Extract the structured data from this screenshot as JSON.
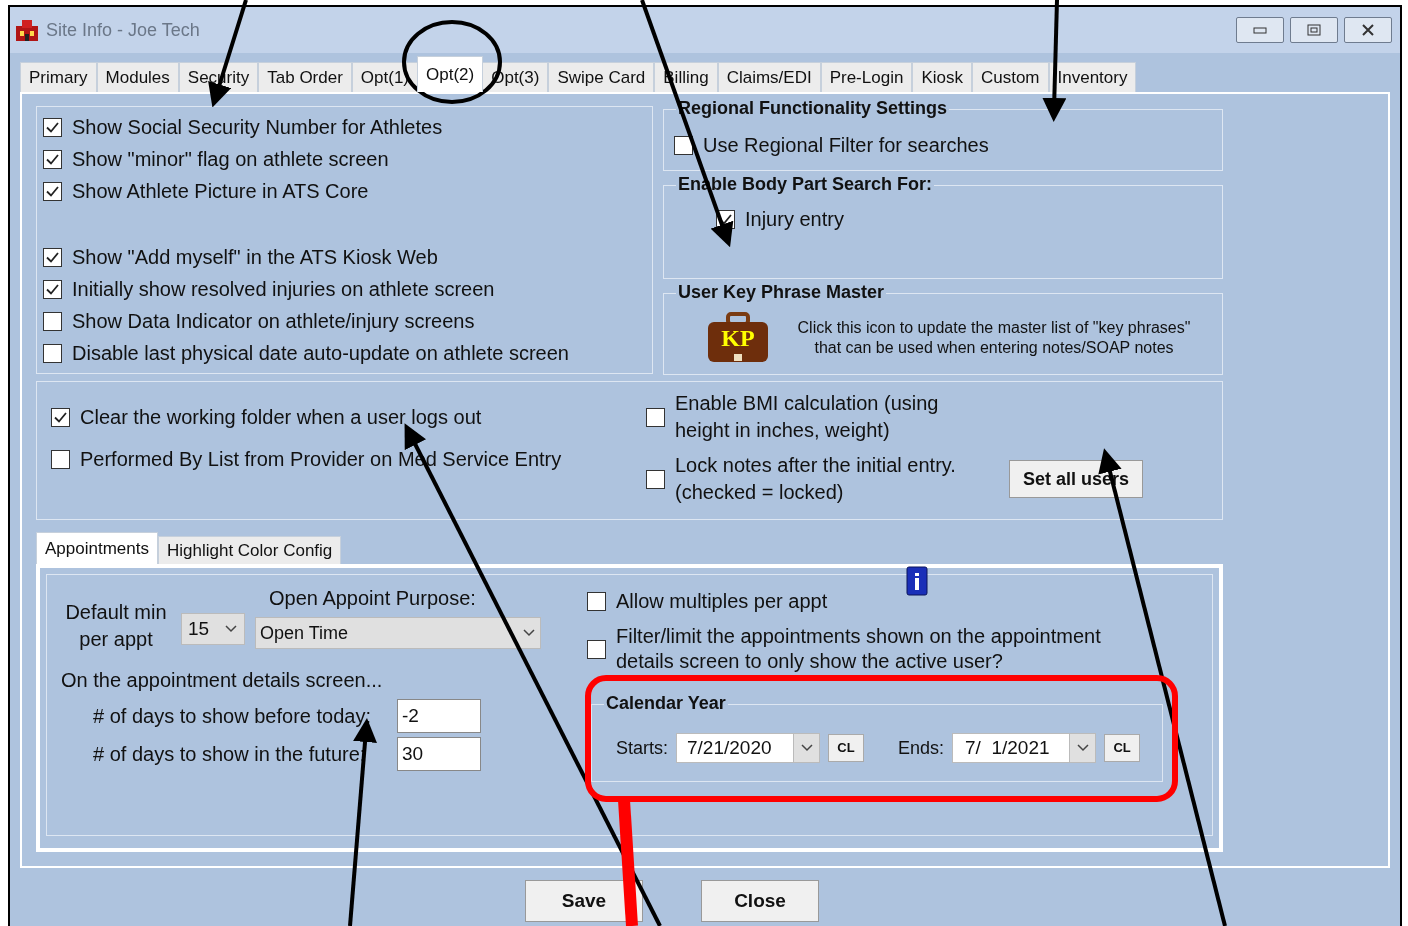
{
  "window": {
    "title": "Site Info - Joe Tech"
  },
  "tabs": [
    {
      "label": "Primary",
      "selected": false
    },
    {
      "label": "Modules",
      "selected": false
    },
    {
      "label": "Security",
      "selected": false
    },
    {
      "label": "Tab Order",
      "selected": false
    },
    {
      "label": "Opt(1)",
      "selected": false
    },
    {
      "label": "Opt(2)",
      "selected": true
    },
    {
      "label": "Opt(3)",
      "selected": false
    },
    {
      "label": "Swipe Card",
      "selected": false
    },
    {
      "label": "Billing",
      "selected": false
    },
    {
      "label": "Claims/EDI",
      "selected": false
    },
    {
      "label": "Pre-Login",
      "selected": false
    },
    {
      "label": "Kiosk",
      "selected": false
    },
    {
      "label": "Custom",
      "selected": false
    },
    {
      "label": "Inventory",
      "selected": false
    }
  ],
  "general_options": [
    {
      "label": "Show Social Security Number for Athletes",
      "checked": true
    },
    {
      "label": "Show \"minor\" flag on athlete screen",
      "checked": true
    },
    {
      "label": "Show Athlete Picture in ATS Core",
      "checked": true
    },
    {
      "label": "Show \"Add myself\" in the ATS Kiosk Web",
      "checked": true
    },
    {
      "label": "Initially show resolved injuries on athlete screen",
      "checked": true
    },
    {
      "label": "Show Data Indicator on athlete/injury screens",
      "checked": false
    },
    {
      "label": "Disable last physical date auto-update on athlete screen",
      "checked": false
    }
  ],
  "regional": {
    "title": "Regional Functionality Settings",
    "option": {
      "label": "Use Regional Filter for searches",
      "checked": false
    }
  },
  "body_part": {
    "title": "Enable Body Part Search For:",
    "option": {
      "label": "Injury entry",
      "checked": true
    }
  },
  "key_phrase": {
    "title": "User Key Phrase Master",
    "icon_text": "KP",
    "hint": "Click this icon to update the master list of \"key phrases\" that can be used when entering notes/SOAP notes"
  },
  "session_options": [
    {
      "label": "Clear the working folder when a user logs out",
      "checked": true
    },
    {
      "label": "Performed By List from Provider on Med Service Entry",
      "checked": false
    }
  ],
  "note_options": [
    {
      "label": "Enable BMI calculation (using height in inches, weight)",
      "checked": false
    },
    {
      "label": "Lock notes after the initial entry. (checked = locked)",
      "checked": false
    }
  ],
  "set_all_users_button": "Set all users",
  "inner_tabs": [
    {
      "label": "Appointments",
      "selected": true
    },
    {
      "label": "Highlight Color Config",
      "selected": false
    }
  ],
  "appointments": {
    "default_min_label": "Default min per appt",
    "default_min_value": "15",
    "purpose_label": "Open Appoint Purpose:",
    "purpose_value": "Open Time",
    "details_heading": "On the appointment details screen...",
    "days_before_label": "# of days to show before today:",
    "days_before_value": "-2",
    "days_future_label": "# of days to show in the future:",
    "days_future_value": "30",
    "options": [
      {
        "label": "Allow multiples per appt",
        "checked": false
      },
      {
        "label": "Filter/limit the appointments shown on the appointment details screen to only show the active user?",
        "checked": false
      }
    ],
    "calendar_year": {
      "title": "Calendar Year",
      "starts_label": "Starts:",
      "starts_value": "7/21/2020",
      "ends_label": "Ends:",
      "ends_value": "7/  1/2021",
      "start_clear_button": "CL",
      "end_clear_button": "CL"
    }
  },
  "buttons": [
    "Save",
    "Close"
  ]
}
